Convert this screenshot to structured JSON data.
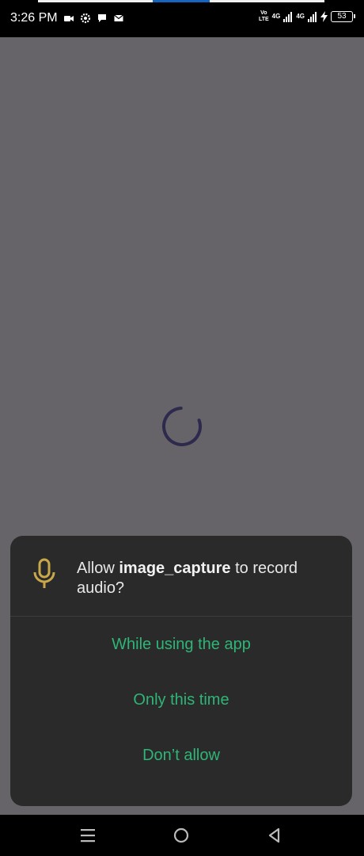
{
  "status_bar": {
    "time": "3:26 PM",
    "notification_icons": [
      "video-camera-icon",
      "settings-gear-icon",
      "chat-bubble-icon",
      "mail-icon"
    ],
    "network_label_volte_top": "Vo",
    "network_label_volte_bottom": "LTE",
    "signal1_label": "4G",
    "signal2_label": "4G",
    "battery_level": "53"
  },
  "dialog": {
    "prompt_prefix": "Allow ",
    "app_name": "image_capture",
    "prompt_suffix": " to record audio?",
    "options": [
      {
        "label": "While using the app"
      },
      {
        "label": "Only this time"
      },
      {
        "label": "Don’t allow"
      }
    ],
    "icon": "microphone-icon",
    "option_color": "#2fb577",
    "icon_color": "#c9a84a"
  },
  "loading": {
    "icon": "loading-spinner",
    "color": "#2e2a4e"
  },
  "nav_bar": {
    "buttons": [
      "recents-button",
      "home-button",
      "back-button"
    ]
  }
}
